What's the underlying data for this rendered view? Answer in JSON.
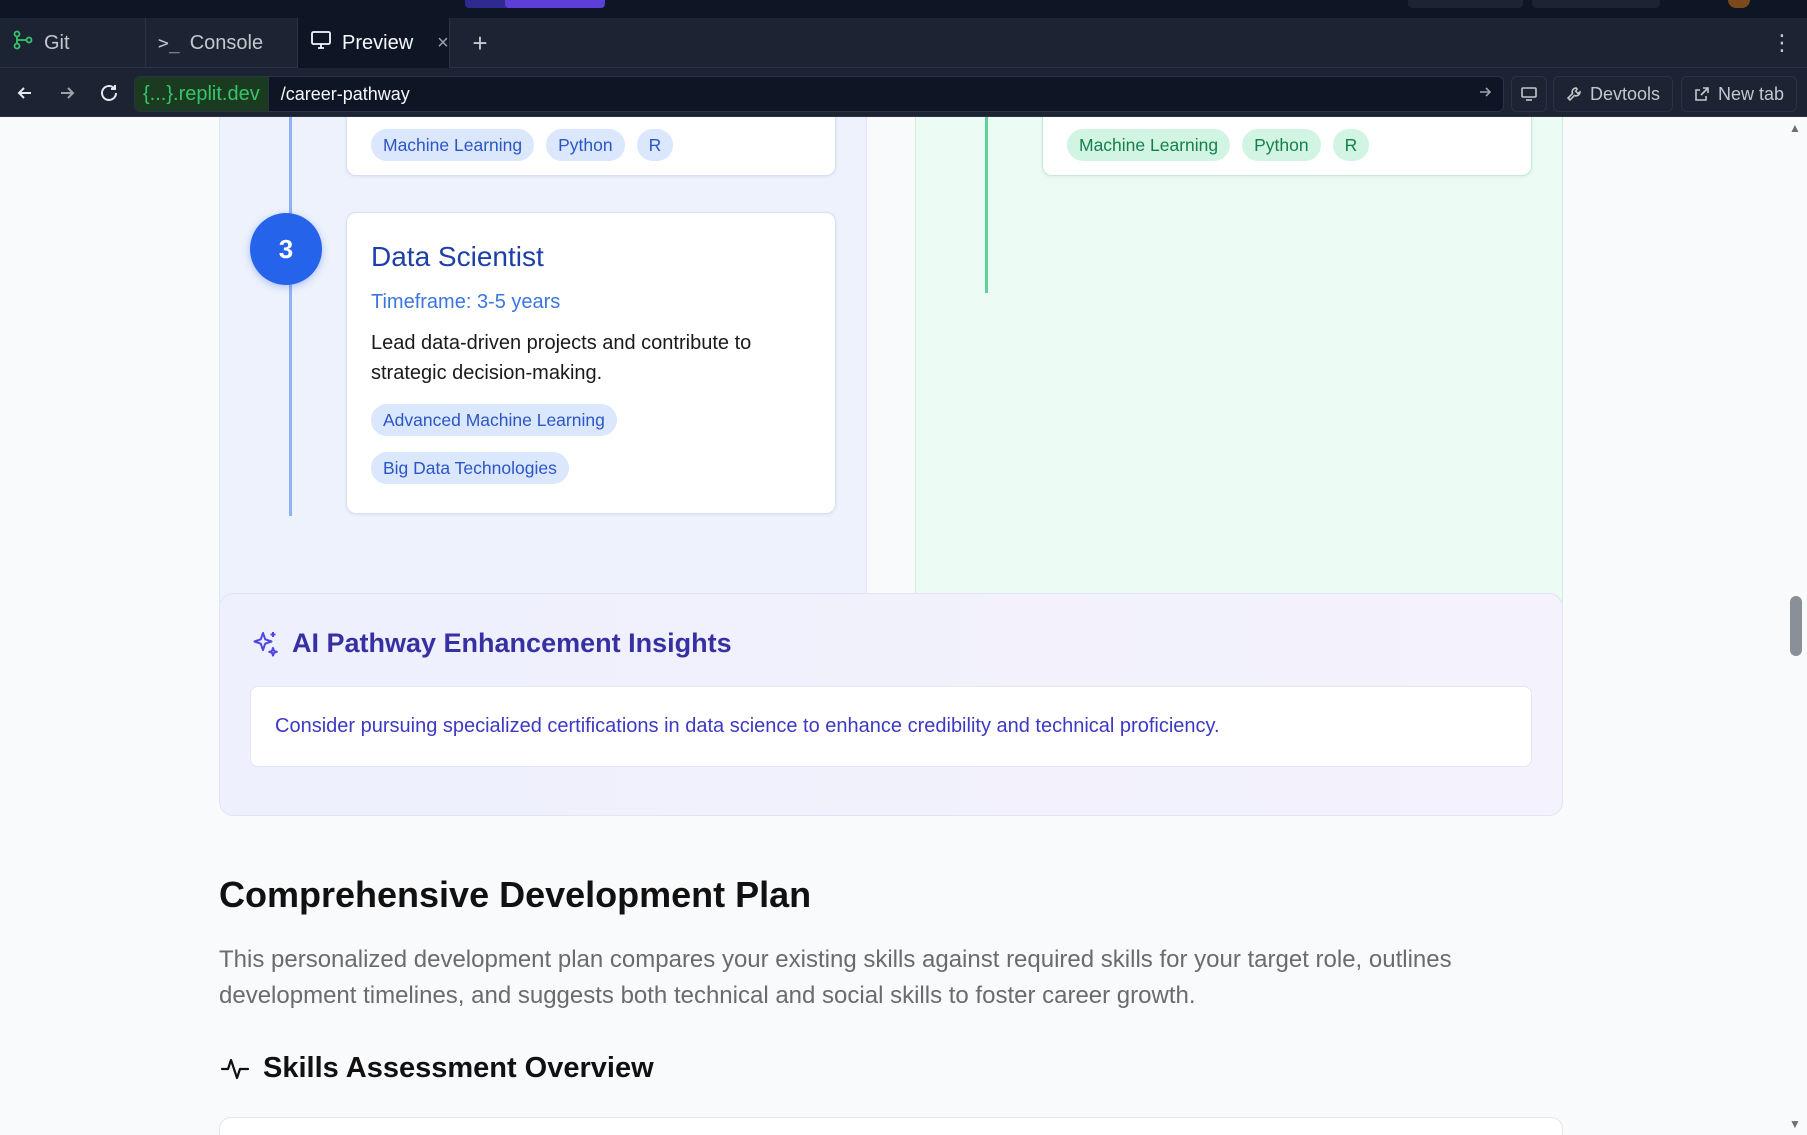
{
  "tabs": {
    "git": "Git",
    "console": "Console",
    "preview": "Preview"
  },
  "urlbar": {
    "domain": "{...}.replit.dev",
    "path": "/career-pathway",
    "devtools": "Devtools",
    "new_tab": "New tab"
  },
  "pathway_blue": {
    "prev_tags": [
      "Machine Learning",
      "Python",
      "R"
    ],
    "step": {
      "number": "3",
      "title": "Data Scientist",
      "timeframe": "Timeframe: 3-5 years",
      "description": "Lead data-driven projects and contribute to strategic decision-making.",
      "tags": [
        "Advanced Machine Learning",
        "Big Data Technologies"
      ]
    }
  },
  "pathway_green": {
    "prev_tags": [
      "Machine Learning",
      "Python",
      "R"
    ]
  },
  "insights": {
    "title": "AI Pathway Enhancement Insights",
    "text": "Consider pursuing specialized certifications in data science to enhance credibility and technical proficiency."
  },
  "development": {
    "title": "Comprehensive Development Plan",
    "description": "This personalized development plan compares your existing skills against required skills for your target role, outlines development timelines, and suggests both technical and social skills to foster career growth.",
    "skills_heading": "Skills Assessment Overview"
  },
  "colors": {
    "primary_blue": "#2563eb",
    "accent_indigo": "#3730a3",
    "green_accent": "#16804c",
    "replit_green": "#37c46b"
  },
  "icons": {
    "git": "git-branch-icon",
    "console": "terminal-icon",
    "preview": "monitor-icon",
    "insights": "sparkles-icon",
    "skills": "activity-icon"
  }
}
